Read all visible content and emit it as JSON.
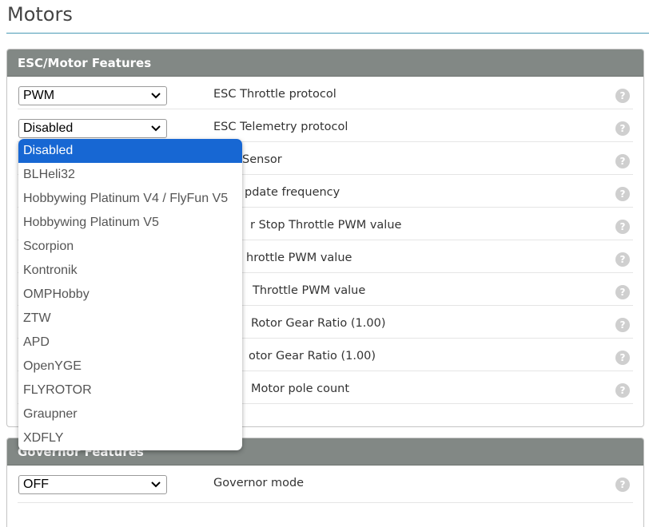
{
  "page": {
    "title": "Motors"
  },
  "esc_panel": {
    "title": "ESC/Motor Features",
    "rows": [
      {
        "select": "PWM",
        "label": "ESC Throttle protocol"
      },
      {
        "select": "Disabled",
        "label": "ESC Telemetry protocol"
      },
      {
        "select": "",
        "label": "Sensor"
      },
      {
        "select": "",
        "label": "pdate frequency"
      },
      {
        "select": "",
        "label": "r Stop Throttle PWM value"
      },
      {
        "select": "",
        "label": "hrottle PWM value"
      },
      {
        "select": "",
        "label": "Throttle PWM value"
      },
      {
        "select": "",
        "label": "Rotor Gear Ratio (1.00)"
      },
      {
        "select": "",
        "label": "otor Gear Ratio (1.00)"
      },
      {
        "select": "",
        "label": "Motor pole count"
      }
    ]
  },
  "governor_panel": {
    "title": "Governor Features",
    "rows": [
      {
        "select": "OFF",
        "label": "Governor mode"
      }
    ]
  },
  "dropdown": {
    "selected": "Disabled",
    "options": [
      "Disabled",
      "BLHeli32",
      "Hobbywing Platinum V4 / FlyFun V5",
      "Hobbywing Platinum V5",
      "Scorpion",
      "Kontronik",
      "OMPHobby",
      "ZTW",
      "APD",
      "OpenYGE",
      "FLYROTOR",
      "Graupner",
      "XDFLY"
    ]
  },
  "help_icon": "question-mark-icon"
}
